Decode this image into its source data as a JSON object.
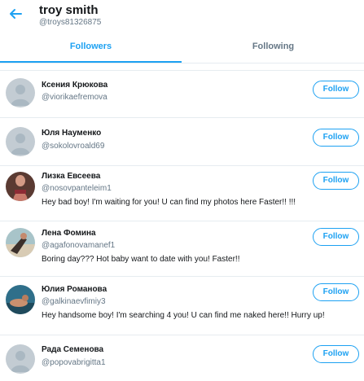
{
  "header": {
    "back_icon": "arrow-left-icon",
    "title": "troy smith",
    "handle": "@troys81326875"
  },
  "tabs": [
    {
      "label": "Followers",
      "active": true
    },
    {
      "label": "Following",
      "active": false
    }
  ],
  "colors": {
    "accent": "#1da1f2",
    "text": "#14171a",
    "muted": "#657786",
    "divider": "#e6ecf0",
    "default_avatar": "#c3ccd3"
  },
  "users": [
    {
      "name": "Ксения Крюкова",
      "username": "@viorikaefremova",
      "bio": "",
      "avatar": "default-avatar",
      "button": "Follow"
    },
    {
      "name": "Юля Науменко",
      "username": "@sokolovroald69",
      "bio": "",
      "avatar": "default-avatar",
      "button": "Follow"
    },
    {
      "name": "Лизка Евсеева",
      "username": "@nosovpanteleim1",
      "bio": "Hey bad boy! I'm waiting for you! U can find my photos here Faster!! !!!",
      "avatar": "photo-avatar",
      "button": "Follow"
    },
    {
      "name": "Лена Фомина",
      "username": "@agafonovamanef1",
      "bio": "Boring day??? Hot baby want to date with you! Faster!!",
      "avatar": "photo-avatar",
      "button": "Follow"
    },
    {
      "name": "Юлия Романова",
      "username": "@galkinaevfimiy3",
      "bio": "Hey handsome boy! I'm searching 4 you! U can find me naked here!! Hurry up!",
      "avatar": "photo-avatar",
      "button": "Follow"
    },
    {
      "name": "Рада Семенова",
      "username": "@popovabrigitta1",
      "bio": "",
      "avatar": "default-avatar",
      "button": "Follow"
    }
  ]
}
